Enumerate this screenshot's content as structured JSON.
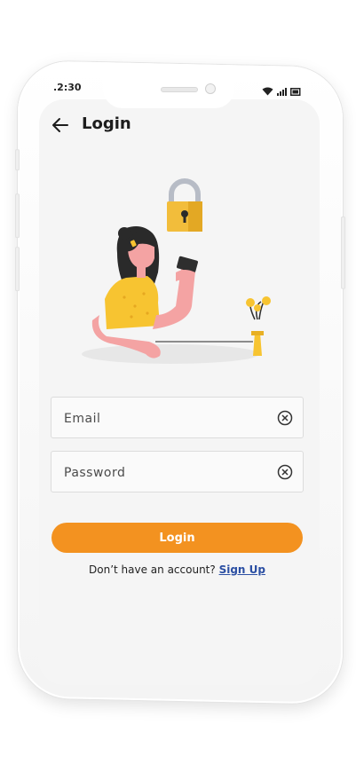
{
  "status_bar": {
    "time": ".2:30"
  },
  "header": {
    "title": "Login",
    "back_icon": "arrow-left-icon"
  },
  "illustration": {
    "name": "woman-with-phone-and-padlock-illustration"
  },
  "form": {
    "email_placeholder": "Email",
    "password_placeholder": "Password",
    "clear_icon": "circle-x-icon",
    "login_label": "Login",
    "signup_prompt": "Don’t have an account?",
    "signup_label": "Sign Up"
  },
  "colors": {
    "accent": "#f39220",
    "link": "#2b4fa3",
    "lock": "#f2bd3b",
    "shirt": "#f7c431",
    "skin": "#f4a3a3"
  }
}
